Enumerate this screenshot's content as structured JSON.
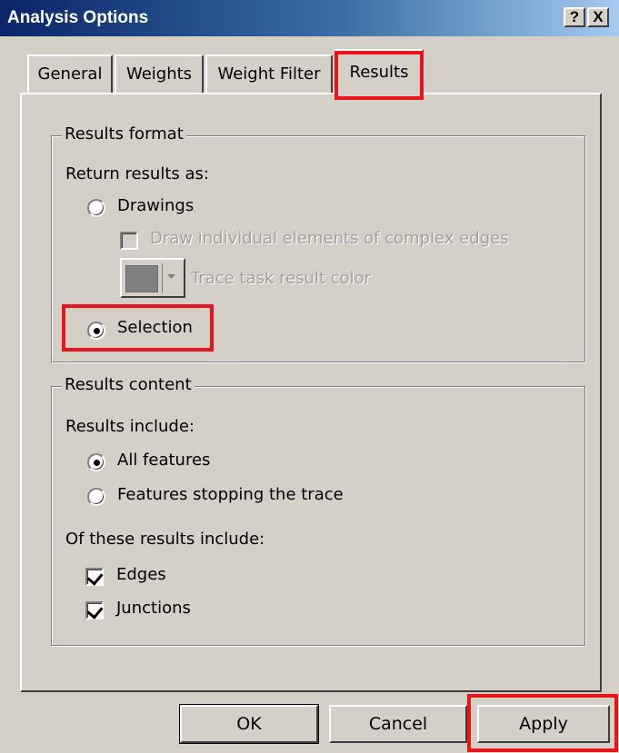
{
  "window": {
    "title": "Analysis Options",
    "help_label": "?",
    "close_label": "X"
  },
  "tabs": [
    {
      "label": "General",
      "active": false
    },
    {
      "label": "Weights",
      "active": false
    },
    {
      "label": "Weight Filter",
      "active": false
    },
    {
      "label": "Results",
      "active": true
    }
  ],
  "results_format": {
    "legend": "Results format",
    "prompt": "Return results as:",
    "drawings_label": "Drawings",
    "drawings_selected": false,
    "draw_elements_label": "Draw individual elements of complex edges",
    "draw_elements_checked": false,
    "draw_elements_enabled": false,
    "trace_color_label": "Trace task result color",
    "trace_color_swatch": "#808080",
    "selection_label": "Selection",
    "selection_selected": true
  },
  "results_content": {
    "legend": "Results content",
    "include_prompt": "Results include:",
    "all_features_label": "All features",
    "all_features_selected": true,
    "stopping_features_label": "Features stopping the trace",
    "stopping_features_selected": false,
    "of_these_prompt": "Of these results include:",
    "edges_label": "Edges",
    "edges_checked": true,
    "junctions_label": "Junctions",
    "junctions_checked": true
  },
  "buttons": {
    "ok": "OK",
    "cancel": "Cancel",
    "apply": "Apply"
  },
  "highlight_color": "#e8141a"
}
